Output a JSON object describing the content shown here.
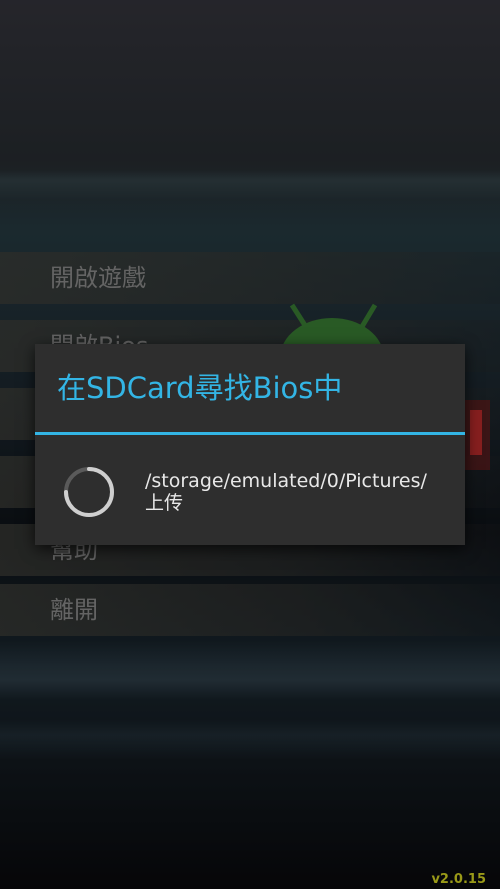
{
  "menu": {
    "items": [
      {
        "label": "開啟遊戲"
      },
      {
        "label": "開啟Bios"
      },
      {
        "label": ""
      },
      {
        "label": ""
      },
      {
        "label": "幫助"
      },
      {
        "label": "離開"
      }
    ]
  },
  "dialog": {
    "title": "在SDCard尋找Bios中",
    "message": "/storage/emulated/0/Pictures/上传",
    "accent_color": "#33b5e5",
    "spinner_icon": "progress-spinner-icon"
  },
  "footer": {
    "version": "v2.0.15"
  }
}
